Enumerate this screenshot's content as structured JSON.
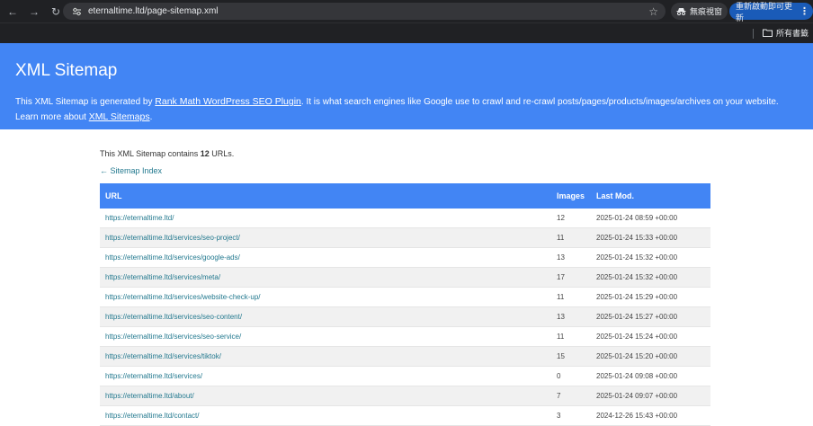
{
  "browser": {
    "url": "eternaltime.ltd/page-sitemap.xml",
    "incognito_label": "無痕視窗",
    "relaunch_label": "重新啟動即可更新",
    "all_bookmarks_label": "所有書籤"
  },
  "header": {
    "title": "XML Sitemap",
    "desc_1": "This XML Sitemap is generated by ",
    "plugin_link": "Rank Math WordPress SEO Plugin",
    "desc_2": ". It is what search engines like Google use to crawl and re-crawl posts/pages/products/images/archives on your website.",
    "desc_3": "Learn more about ",
    "sitemaps_link": "XML Sitemaps",
    "desc_4": "."
  },
  "summary": {
    "prefix": "This XML Sitemap contains ",
    "count": "12",
    "suffix": " URLs."
  },
  "back_link": "← Sitemap Index",
  "table": {
    "headers": {
      "url": "URL",
      "images": "Images",
      "lastmod": "Last Mod."
    },
    "rows": [
      {
        "url": "https://eternaltime.ltd/",
        "images": "12",
        "lastmod": "2025-01-24 08:59 +00:00"
      },
      {
        "url": "https://eternaltime.ltd/services/seo-project/",
        "images": "11",
        "lastmod": "2025-01-24 15:33 +00:00"
      },
      {
        "url": "https://eternaltime.ltd/services/google-ads/",
        "images": "13",
        "lastmod": "2025-01-24 15:32 +00:00"
      },
      {
        "url": "https://eternaltime.ltd/services/meta/",
        "images": "17",
        "lastmod": "2025-01-24 15:32 +00:00"
      },
      {
        "url": "https://eternaltime.ltd/services/website-check-up/",
        "images": "11",
        "lastmod": "2025-01-24 15:29 +00:00"
      },
      {
        "url": "https://eternaltime.ltd/services/seo-content/",
        "images": "13",
        "lastmod": "2025-01-24 15:27 +00:00"
      },
      {
        "url": "https://eternaltime.ltd/services/seo-service/",
        "images": "11",
        "lastmod": "2025-01-24 15:24 +00:00"
      },
      {
        "url": "https://eternaltime.ltd/services/tiktok/",
        "images": "15",
        "lastmod": "2025-01-24 15:20 +00:00"
      },
      {
        "url": "https://eternaltime.ltd/services/",
        "images": "0",
        "lastmod": "2025-01-24 09:08 +00:00"
      },
      {
        "url": "https://eternaltime.ltd/about/",
        "images": "7",
        "lastmod": "2025-01-24 09:07 +00:00"
      },
      {
        "url": "https://eternaltime.ltd/contact/",
        "images": "3",
        "lastmod": "2024-12-26 15:43 +00:00"
      }
    ]
  },
  "colors": {
    "header_bg": "#4285f4",
    "link": "#23798f",
    "chrome_bg": "#202124"
  }
}
